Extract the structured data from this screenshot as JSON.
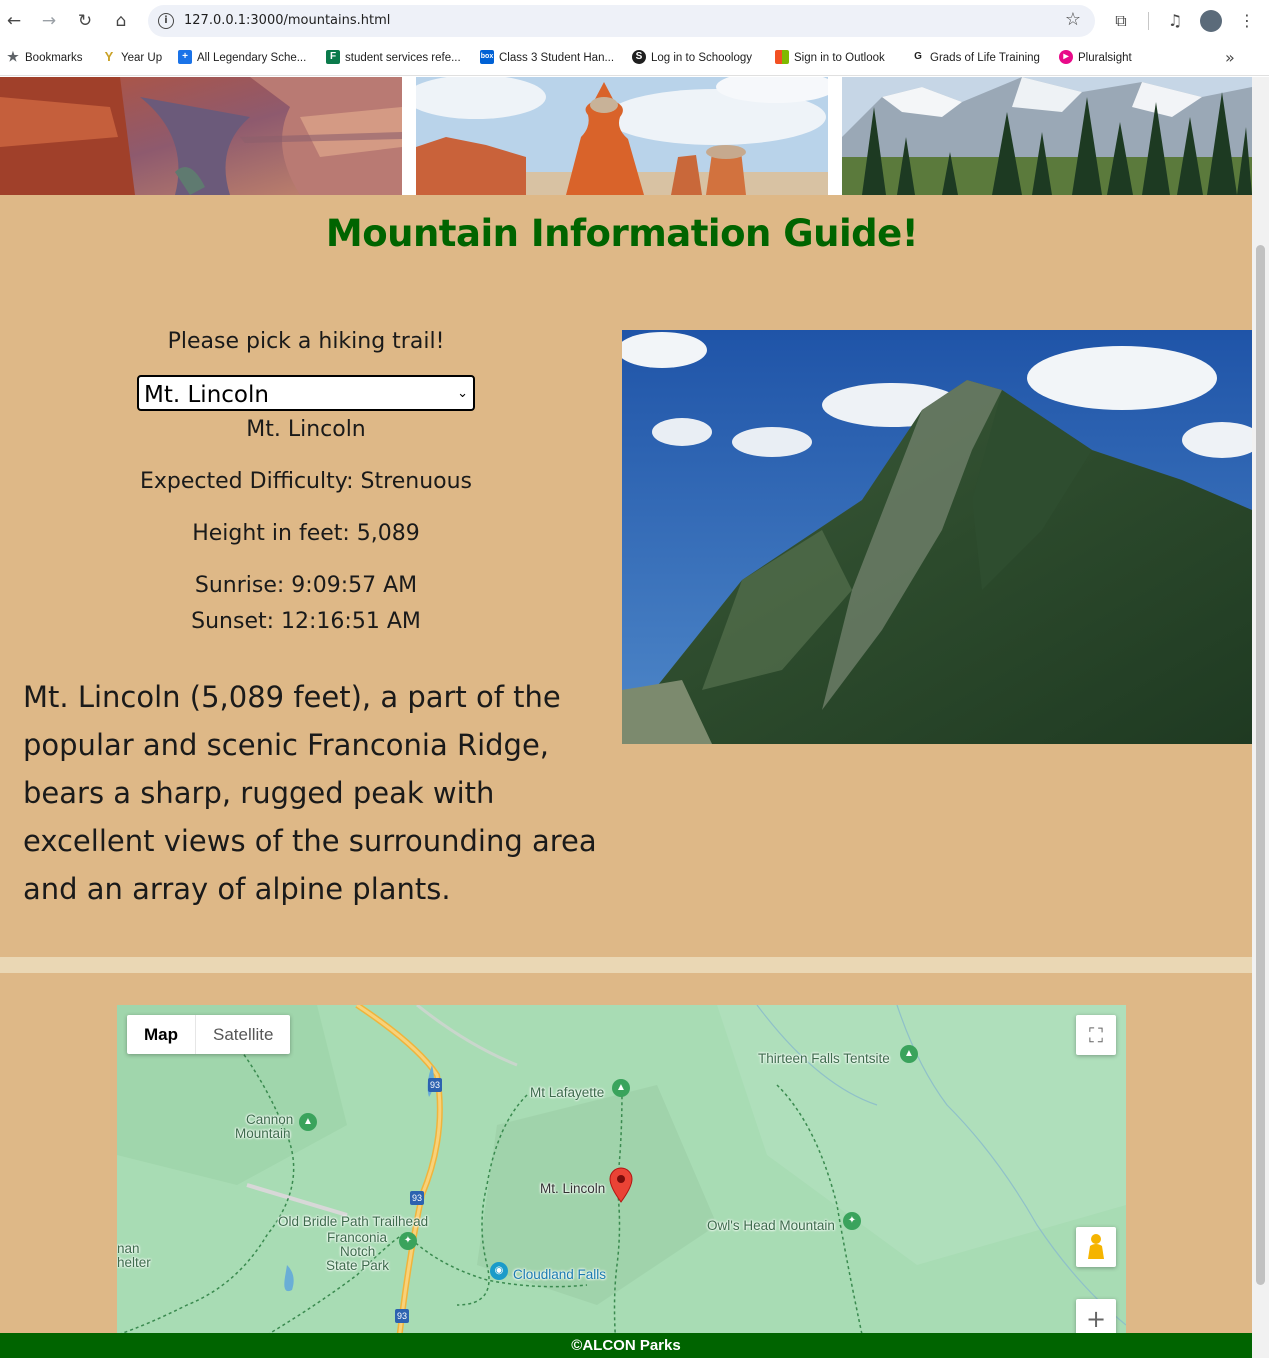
{
  "browser": {
    "url": "127.0.0.1:3000/mountains.html",
    "bookmarks": [
      {
        "label": "Bookmarks",
        "icon": "star-icon",
        "color": "#5f6368"
      },
      {
        "label": "Year Up",
        "icon": "yearup-icon",
        "color": "#c9a227"
      },
      {
        "label": "All Legendary Sche...",
        "icon": "plus-icon",
        "color": "#1a73e8"
      },
      {
        "label": "student services refe...",
        "icon": "forms-icon",
        "color": "#0b7a4b"
      },
      {
        "label": "Class 3 Student Han...",
        "icon": "box-icon",
        "color": "#0061d5"
      },
      {
        "label": "Log in to Schoology",
        "icon": "schoology-icon",
        "color": "#1f1f1f"
      },
      {
        "label": "Sign in to Outlook",
        "icon": "microsoft-icon",
        "color": "#f25022"
      },
      {
        "label": "Grads of Life Training",
        "icon": "g-icon",
        "color": "#1f1f1f"
      },
      {
        "label": "Pluralsight",
        "icon": "pluralsight-icon",
        "color": "#e80a89"
      }
    ]
  },
  "page": {
    "heading": "Mountain Information Guide!",
    "prompt": "Please pick a hiking trail!",
    "selected_trail": "Mt. Lincoln",
    "trail_name": "Mt. Lincoln",
    "difficulty": "Expected Difficulty: Strenuous",
    "height": "Height in feet: 5,089",
    "sunrise": "Sunrise: 9:09:57 AM",
    "sunset": "Sunset: 12:16:51 AM",
    "description": "Mt. Lincoln (5,089 feet), a part of the popular and scenic Franconia Ridge, bears a sharp, rugged peak with excellent views of the surrounding area and an array of alpine plants.",
    "footer": "©ALCON Parks"
  },
  "map": {
    "type_map": "Map",
    "type_satellite": "Satellite",
    "labels": {
      "thirteen_falls": "Thirteen Falls Tentsite",
      "mt_lafayette": "Mt Lafayette",
      "cannon_1": "Cannon",
      "cannon_2": "Mountain",
      "mt_lincoln": "Mt. Lincoln",
      "owls_head": "Owl's Head Mountain",
      "old_bridle": "Old Bridle Path Trailhead",
      "franconia_1": "Franconia",
      "franconia_2": "Notch",
      "franconia_3": "State Park",
      "cloudland": "Cloudland Falls",
      "edge_1": "nan",
      "edge_2": "helter",
      "route_93": "93"
    }
  }
}
